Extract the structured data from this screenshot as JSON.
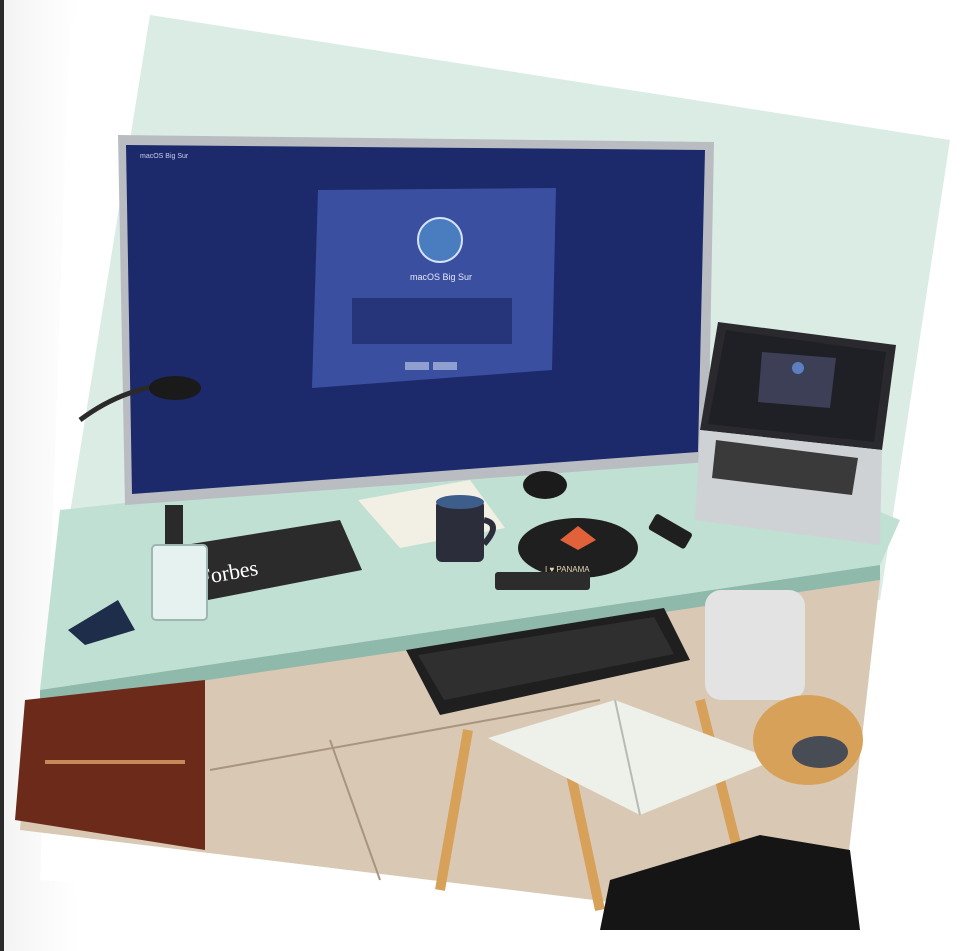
{
  "scene": {
    "type": "photo",
    "style": "tilted-polaroid",
    "colors": {
      "wall": "#dbece4",
      "desk": "#bfe0d2",
      "monitor_screen": "#1c2a6b",
      "dialog": "#3a4fa0",
      "laptop_body": "#cfd2d4",
      "floor": "#d9c8b4",
      "wood": "#d8a15a"
    }
  },
  "monitor": {
    "menubar_text": "macOS Big Sur",
    "dialog_title": "macOS Big Sur"
  },
  "magazine": {
    "title": "Forbes"
  },
  "mousepad": {
    "text": "I ♥ PANAMA"
  }
}
